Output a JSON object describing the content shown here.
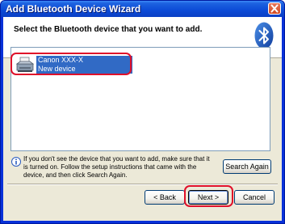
{
  "window": {
    "title": "Add Bluetooth Device Wizard"
  },
  "header": {
    "title": "Select the Bluetooth device that you want to add.",
    "logo_icon": "bluetooth-icon"
  },
  "device_list": {
    "items": [
      {
        "name": "Canon XXX-X",
        "status": "New device",
        "icon": "printer-icon",
        "selected": true
      }
    ]
  },
  "info": {
    "icon": "info-icon",
    "text": "If you don't see the device that you want to add, make sure that it is turned on. Follow the setup instructions that came with the device, and then click Search Again."
  },
  "buttons": {
    "search_again": "Search Again",
    "back": "< Back",
    "next": "Next >",
    "cancel": "Cancel"
  },
  "colors": {
    "titlebar": "#0c4ad6",
    "selection": "#316ac5",
    "highlight_ring": "#e0102a",
    "dialog_bg": "#ece9d8"
  }
}
